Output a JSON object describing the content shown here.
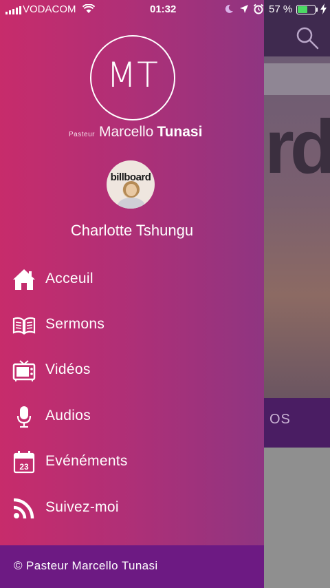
{
  "status_bar": {
    "carrier": "VODACOM",
    "time": "01:32",
    "battery_percent": "57 %",
    "battery_level": 0.57
  },
  "header_logo": {
    "initials": "MT",
    "prefix": "Pasteur",
    "first_name": "Marcello",
    "last_name": "Tunasi"
  },
  "profile": {
    "avatar_text": "billboard",
    "name": "Charlotte Tshungu"
  },
  "menu": [
    {
      "label": "Acceuil",
      "icon": "home-icon"
    },
    {
      "label": "Sermons",
      "icon": "book-icon"
    },
    {
      "label": "Vidéos",
      "icon": "tv-icon"
    },
    {
      "label": "Audios",
      "icon": "microphone-icon"
    },
    {
      "label": "Evénéments",
      "icon": "calendar-icon",
      "icon_text": "23"
    },
    {
      "label": "Suivez-moi",
      "icon": "rss-icon"
    }
  ],
  "footer": {
    "text": "© Pasteur Marcello Tunasi"
  },
  "background": {
    "tab_partial": "OS"
  },
  "colors": {
    "drawer_left": "#c72c6b",
    "drawer_right": "#8f3581",
    "footer_bg": "#6d1a83",
    "battery_fill": "#4cd964"
  }
}
